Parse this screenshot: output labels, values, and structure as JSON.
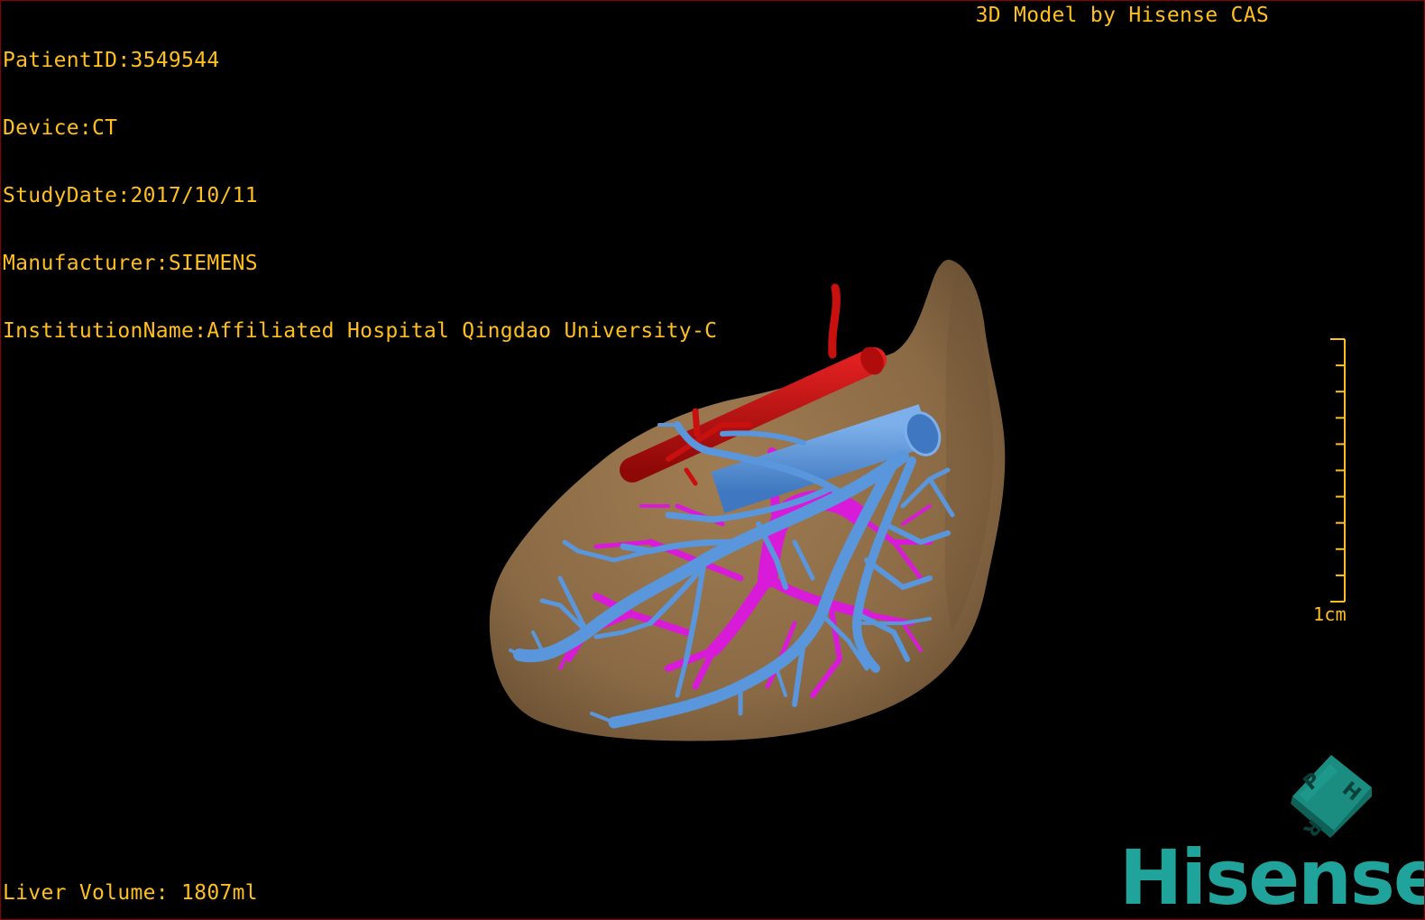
{
  "overlay": {
    "patient_id": "PatientID:3549544",
    "device": "Device:CT",
    "study_date": "StudyDate:2017/10/11",
    "manufacturer": "Manufacturer:SIEMENS",
    "institution": "InstitutionName:Affiliated Hospital Qingdao University-C",
    "credit": "3D Model by Hisense CAS",
    "liver_volume": "Liver Volume: 1807ml"
  },
  "scale_bar": {
    "label": "1cm",
    "ticks": 10
  },
  "orientation_cube": {
    "faces": [
      "P",
      "H",
      "R"
    ],
    "color": "#1a8c80"
  },
  "brand": {
    "logo_text": "Hisense",
    "color": "#1fa39a"
  },
  "structures": [
    {
      "name": "liver",
      "color": "#8a6a45"
    },
    {
      "name": "hepatic-artery-aorta",
      "color": "#c8100f"
    },
    {
      "name": "portal-vein",
      "color": "#d81bd8"
    },
    {
      "name": "hepatic-vein-ivc",
      "color": "#5a96dc"
    }
  ],
  "colors": {
    "overlay_text": "#ffbf1f",
    "background": "#000000",
    "border": "#8b0000"
  }
}
